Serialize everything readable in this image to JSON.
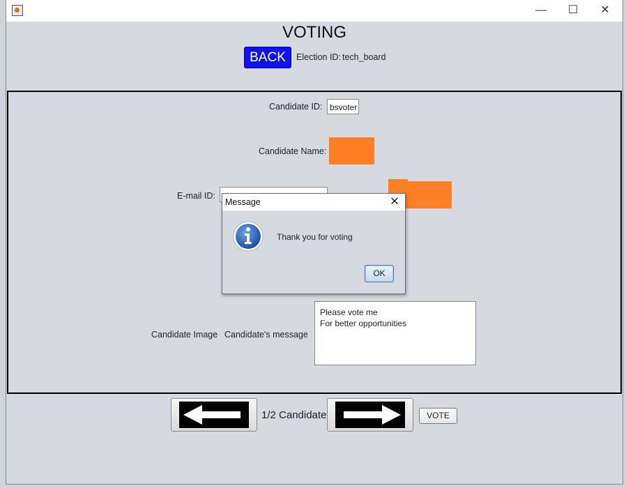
{
  "window": {
    "minimize_glyph": "—",
    "maximize_glyph": "☐",
    "close_glyph": "✕"
  },
  "header": {
    "title": "VOTING",
    "back_label": "BACK",
    "election_label": "Election ID:",
    "election_value": "tech_board"
  },
  "form": {
    "candidate_id_label": "Candidate ID:",
    "candidate_id_value": "bsvoter",
    "candidate_name_label": "Candidate Name:",
    "email_label": "E-mail ID:",
    "candidate_image_label": "Candidate Image",
    "candidate_message_label": "Candidate's message",
    "candidate_message_value": "Please vote me\nFor better opportunities"
  },
  "footer": {
    "page_indicator": "1/2 Candidate",
    "vote_label": "VOTE"
  },
  "dialog": {
    "title": "Message",
    "close_glyph": "✕",
    "message": "Thank you for voting",
    "ok_label": "OK"
  },
  "colors": {
    "back_button": "#1111ee",
    "redaction": "#ff7f27",
    "info_icon": "#2e63b8"
  }
}
